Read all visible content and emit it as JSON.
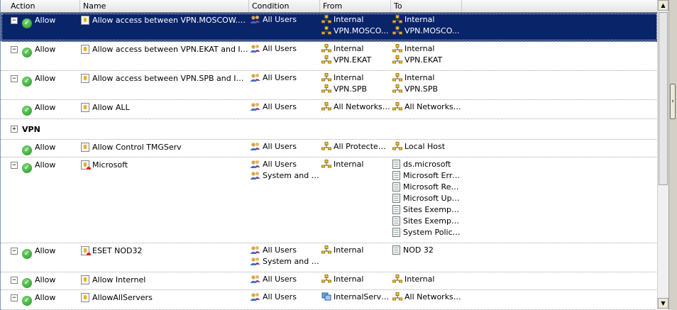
{
  "columns": {
    "action": "Action",
    "name": "Name",
    "condition": "Condition",
    "from": "From",
    "to": "To"
  },
  "rules": [
    {
      "expander": "−",
      "action": "Allow",
      "name": "Allow access between VPN.MOSCOW.BEL ...",
      "condition": [
        "All Users"
      ],
      "from": [
        "Internal",
        "VPN.MOSCO..."
      ],
      "to": [
        "Internal",
        "VPN.MOSCO..."
      ]
    },
    {
      "expander": "−",
      "action": "Allow",
      "name": "Allow access between VPN.EKAT and Internal",
      "condition": [
        "All Users"
      ],
      "from": [
        "Internal",
        "VPN.EKAT"
      ],
      "to": [
        "Internal",
        "VPN.EKAT"
      ]
    },
    {
      "expander": "−",
      "action": "Allow",
      "name": "Allow access between VPN.SPB and Internal",
      "condition": [
        "All Users"
      ],
      "from": [
        "Internal",
        "VPN.SPB"
      ],
      "to": [
        "Internal",
        "VPN.SPB"
      ]
    },
    {
      "action": "Allow",
      "name": "Allow ALL",
      "condition": [
        "All Users"
      ],
      "from": [
        "All Networks (..."
      ],
      "to": [
        "All Networks (..."
      ]
    },
    {
      "group": "VPN",
      "expander": "+"
    },
    {
      "action": "Allow",
      "name": "Allow Control TMGServ",
      "condition": [
        "All Users"
      ],
      "from": [
        "All Protected ..."
      ],
      "to": [
        "Local Host"
      ]
    },
    {
      "expander": "−",
      "action": "Allow",
      "name": "Microsoft",
      "condition": [
        "All Users",
        "System and N..."
      ],
      "from": [
        "Internal"
      ],
      "to": [
        "ds.microsoft",
        "Microsoft Erro...",
        "Microsoft Rep...",
        "Microsoft Upd...",
        "Sites Exempt ...",
        "Sites Exempt ...",
        "System Policy..."
      ]
    },
    {
      "expander": "−",
      "action": "Allow",
      "name": "ESET NOD32",
      "condition": [
        "All Users",
        "System and N..."
      ],
      "from": [
        "Internal"
      ],
      "to": [
        "NOD 32"
      ]
    },
    {
      "expander": "−",
      "action": "Allow",
      "name": "Allow Internel",
      "condition": [
        "All Users"
      ],
      "from": [
        "Internal"
      ],
      "to": [
        "Internal"
      ]
    },
    {
      "expander": "−",
      "action": "Allow",
      "name": "AllowAllServers",
      "condition": [
        "All Users"
      ],
      "from": [
        "InternalServers"
      ],
      "to": [
        "All Networks (..."
      ]
    }
  ],
  "scrollbar": {
    "up_arrow": "▲",
    "down_arrow": "▼",
    "side_handle": "›"
  }
}
